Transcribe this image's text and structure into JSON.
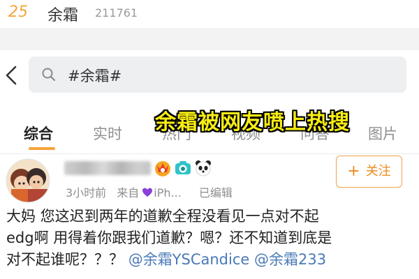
{
  "hot_search": {
    "rank": "25",
    "term": "余霜",
    "count": "211761"
  },
  "search": {
    "query": "#余霜#"
  },
  "tabs": [
    {
      "label": "综合",
      "active": true
    },
    {
      "label": "实时",
      "active": false
    },
    {
      "label": "热门",
      "active": false
    },
    {
      "label": "视频",
      "active": false
    },
    {
      "label": "问答",
      "active": false
    },
    {
      "label": "图片",
      "active": false
    }
  ],
  "overlay_caption": "余霜被网友喷上热搜",
  "post": {
    "time": "3小时前",
    "source_prefix": "来自",
    "source_device": "iPh...",
    "edited": "已编辑",
    "follow_label": "关注",
    "body_line1": "大妈 您这迟到两年的道歉全程没看见一点对不起",
    "body_line2": "edg啊 用得着你跟我们道歉？嗯？还不知道到底是",
    "body_line3_text": "对不起谁呢？？？ ",
    "mention1": "@余霜YSCandice",
    "mention2": "@余霜233",
    "badges": [
      "crown-badge-icon",
      "camera-badge-icon",
      "panda-badge-icon"
    ]
  },
  "colors": {
    "accent": "#f7a438",
    "link": "#4a7ab7",
    "caption_fill": "#f7ec14",
    "follow": "#ef8a1e"
  }
}
